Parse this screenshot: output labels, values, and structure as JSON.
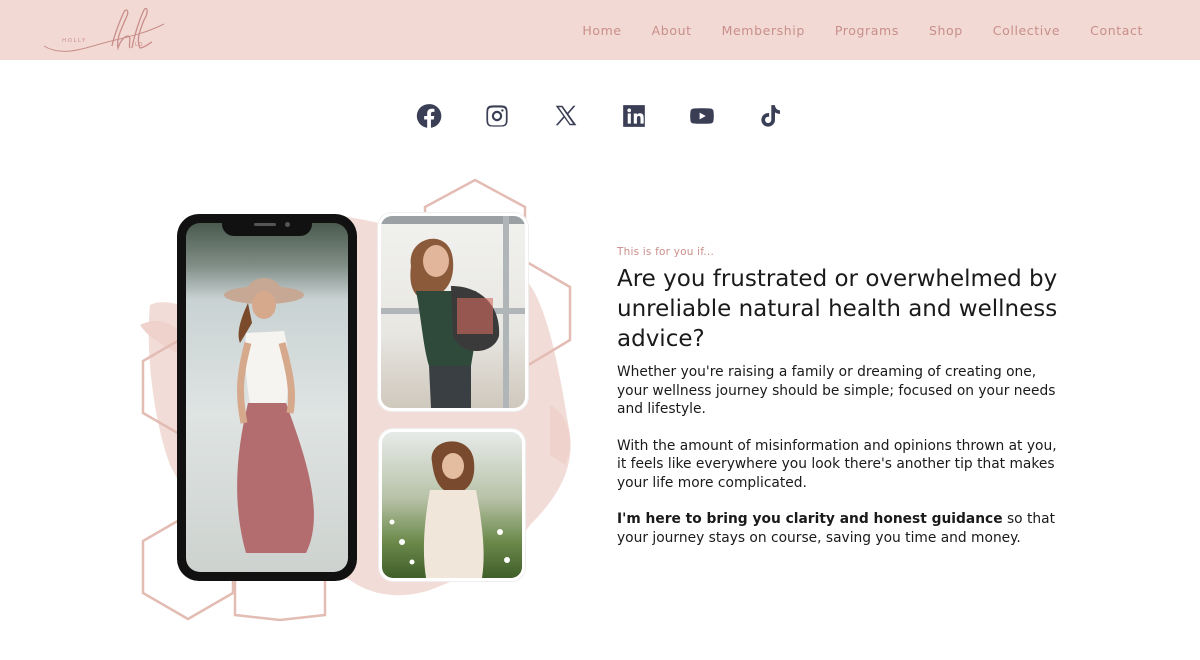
{
  "header": {
    "logo_text": "HOLLY",
    "logo_monogram": "hl",
    "logo_suffix": "LO",
    "nav": [
      {
        "label": "Home"
      },
      {
        "label": "About"
      },
      {
        "label": "Membership"
      },
      {
        "label": "Programs"
      },
      {
        "label": "Shop"
      },
      {
        "label": "Collective"
      },
      {
        "label": "Contact"
      }
    ]
  },
  "social": [
    {
      "icon": "facebook-icon"
    },
    {
      "icon": "instagram-icon"
    },
    {
      "icon": "x-twitter-icon"
    },
    {
      "icon": "linkedin-icon"
    },
    {
      "icon": "youtube-icon"
    },
    {
      "icon": "tiktok-icon"
    }
  ],
  "colors": {
    "header_bg": "#f2d9d4",
    "nav_text": "#c98e8a",
    "accent_pink": "#e9c5be",
    "icon_color": "#3b3f55"
  },
  "content": {
    "eyebrow": "This is for you if...",
    "headline": "Are you frustrated or overwhelmed by unreliable natural health and wellness advice?",
    "para1": "Whether you're raising a family or dreaming of creating one, your wellness journey should be simple; focused on your needs and lifestyle.",
    "para2": "With the amount of misinformation and opinions thrown at you, it feels like everywhere you look there's another tip that makes your life more complicated.",
    "para3_bold": "I'm here to bring you clarity and honest guidance",
    "para3_rest": " so that your journey stays on course, saving you time and money."
  }
}
